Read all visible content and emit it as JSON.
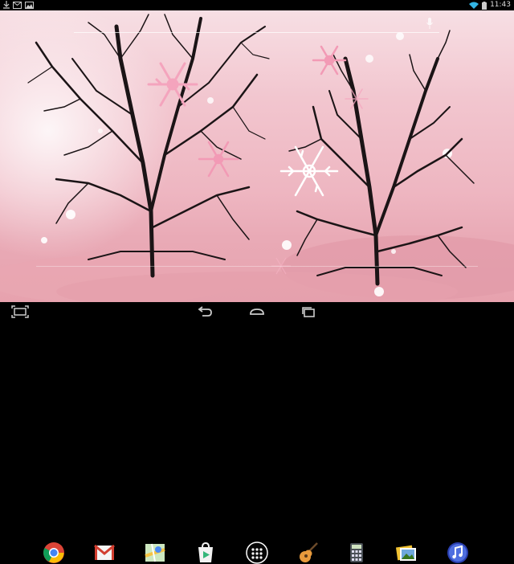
{
  "status_bar": {
    "time": "11:43",
    "left_icons": [
      "download-icon",
      "gmail-notification-icon",
      "image-notification-icon"
    ],
    "right_icons": [
      "wifi-icon",
      "battery-icon"
    ]
  },
  "home_screen": {
    "search_bar": {
      "icon": "microphone-icon"
    },
    "dock": [
      {
        "app": "chrome-icon"
      },
      {
        "app": "gmail-icon"
      },
      {
        "app": "maps-icon"
      },
      {
        "app": "play-store-icon"
      },
      {
        "app": "all-apps-icon"
      },
      {
        "app": "guitar-icon"
      },
      {
        "app": "calculator-icon"
      },
      {
        "app": "gallery-icon"
      },
      {
        "app": "music-icon"
      }
    ]
  },
  "nav_bar": {
    "buttons": [
      "screenshot-icon",
      "back-icon",
      "home-icon",
      "recent-apps-icon"
    ]
  },
  "colors": {
    "sky_top": "#f7dfe4",
    "sky_bottom": "#e7a2ae",
    "snowflake_pink": "#f4a4bd",
    "bar_background": "#000000"
  }
}
